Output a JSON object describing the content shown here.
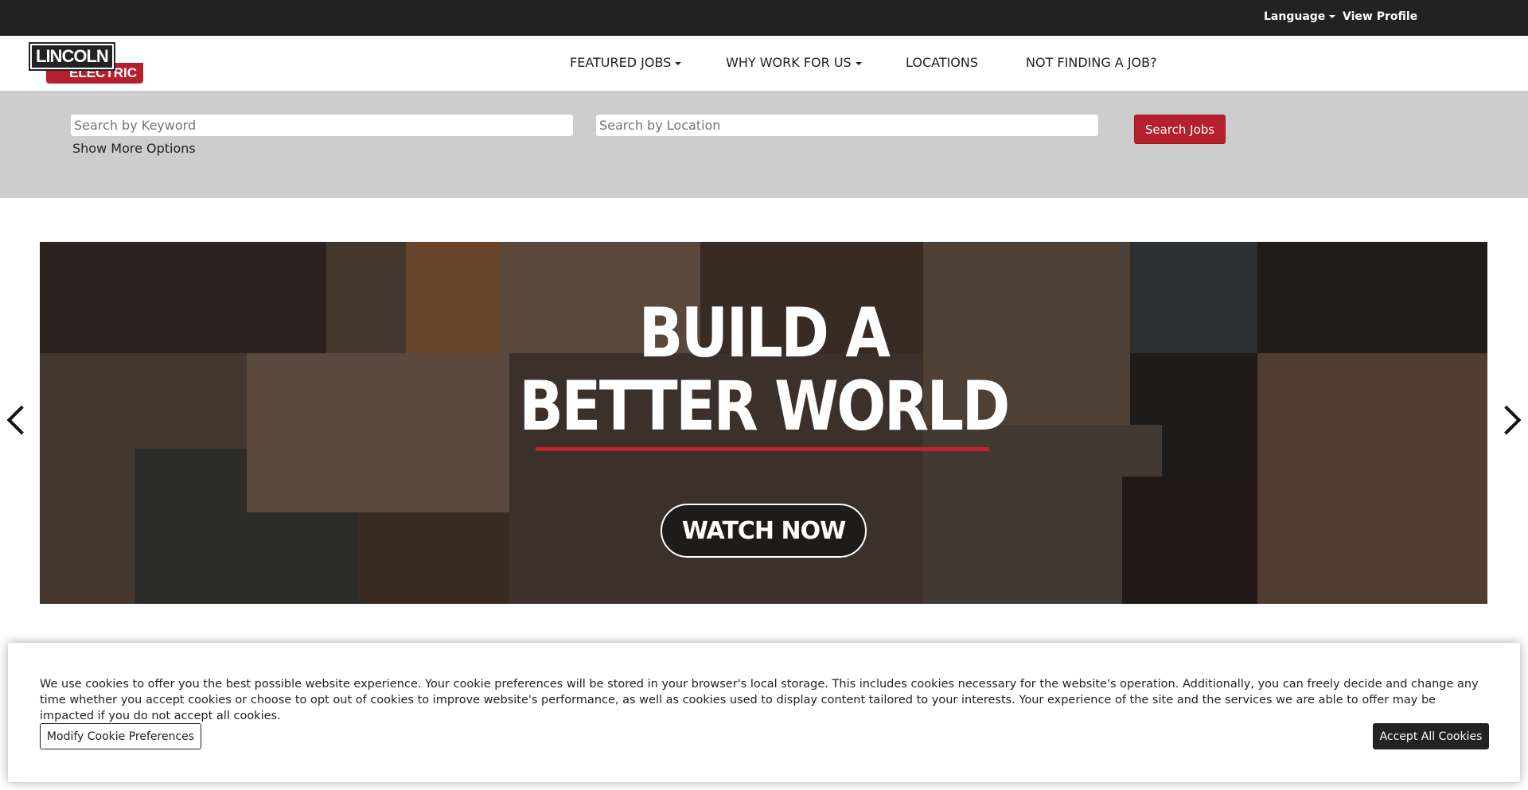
{
  "topbar": {
    "language": "Language",
    "view_profile": "View Profile"
  },
  "logo": {
    "line1": "LINCOLN",
    "line2": "ELECTRIC"
  },
  "nav": [
    {
      "label": "FEATURED JOBS",
      "dropdown": true
    },
    {
      "label": "WHY WORK FOR US",
      "dropdown": true
    },
    {
      "label": "LOCATIONS"
    },
    {
      "label": "NOT FINDING A JOB?"
    }
  ],
  "search": {
    "keyword_placeholder": "Search by Keyword",
    "location_placeholder": "Search by Location",
    "button": "Search Jobs",
    "more_options": "Show More Options"
  },
  "hero": {
    "line1": "BUILD A",
    "line2": "BETTER WORLD",
    "cta": "WATCH NOW",
    "accent": "#c4212f"
  },
  "cookie": {
    "text": "We use cookies to offer you the best possible website experience. Your cookie preferences will be stored in your browser's local storage. This includes cookies necessary for the website's operation. Additionally, you can freely decide and change any time whether you accept cookies or choose to opt out of cookies to improve website's performance, as well as cookies used to display content tailored to your interests. Your experience of the site and the services we are able to offer may be impacted if you do not accept all cookies.",
    "modify": "Modify Cookie Preferences",
    "accept": "Accept All Cookies"
  },
  "colors": {
    "brand_red": "#b5202e",
    "topbar": "#222222",
    "search_band": "#cdcdcd"
  }
}
